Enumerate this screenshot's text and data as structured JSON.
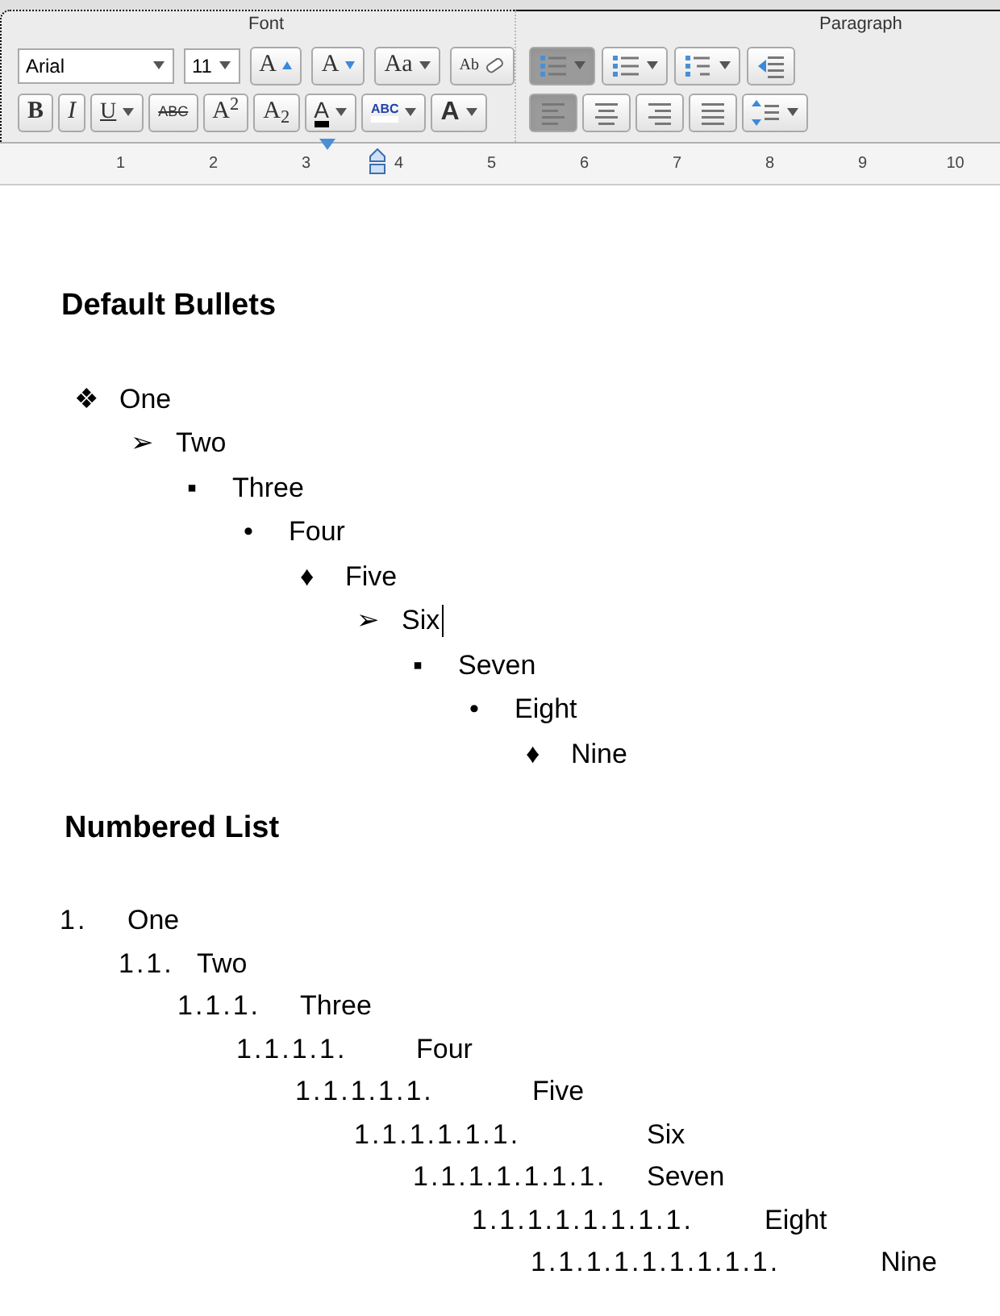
{
  "ribbon": {
    "font_group": {
      "title": "Font",
      "font_name": "Arial",
      "font_size": "11",
      "row1": [
        {
          "kind": "text",
          "label": "A"
        },
        {
          "kind": "text",
          "label": "A"
        },
        {
          "kind": "text",
          "label": "Aa"
        },
        {
          "kind": "text",
          "label": "Ab"
        }
      ],
      "row2": [
        {
          "kind": "text",
          "label": "B"
        },
        {
          "kind": "text",
          "label": "I"
        },
        {
          "kind": "text",
          "label": "U"
        },
        {
          "kind": "text",
          "label": "ABC"
        },
        {
          "kind": "text",
          "label": "A$^{2}$"
        },
        {
          "kind": "text",
          "label": "A$_{2}$"
        },
        {
          "kind": "text",
          "label": "A"
        },
        {
          "kind": "text",
          "label": "ABC"
        },
        {
          "kind": "text",
          "label": "A"
        }
      ]
    },
    "paragraph_group": {
      "title": "Paragraph",
      "row1": [
        {
          "kind": "icon",
          "selected": true
        },
        {
          "kind": "icon",
          "selected": false
        },
        {
          "kind": "icon",
          "selected": false
        },
        {
          "kind": "icon"
        }
      ],
      "row2": [
        {
          "kind": "icon",
          "selected": true
        },
        {
          "kind": "icon",
          "selected": false
        },
        {
          "kind": "icon",
          "selected": false
        },
        {
          "kind": "icon",
          "selected": false
        },
        {
          "kind": "icon"
        }
      ]
    }
  },
  "ruler": {
    "numbers": [
      "1",
      "2",
      "3",
      "4",
      "5",
      "6",
      "7",
      "8",
      "9",
      "10"
    ]
  },
  "document": {
    "sections": [
      {
        "heading": "Default Bullets",
        "kind": "bullets",
        "items": [
          {
            "marker": "❖",
            "text": "One",
            "children": [
              {
                "marker": "➢",
                "text": "Two",
                "children": [
                  {
                    "marker": "▪",
                    "text": "Three",
                    "children": [
                      {
                        "marker": "•",
                        "text": "Four",
                        "children": [
                          {
                            "marker": "♦",
                            "text": "Five",
                            "children": [
                              {
                                "marker": "➢",
                                "text": "Six",
                                "caret": true,
                                "children": [
                                  {
                                    "marker": "▪",
                                    "text": "Seven",
                                    "children": [
                                      {
                                        "marker": "•",
                                        "text": "Eight",
                                        "children": [
                                          {
                                            "marker": "♦",
                                            "text": "Nine"
                                          }
                                        ]
                                      }
                                    ]
                                  }
                                ]
                              }
                            ]
                          }
                        ]
                      }
                    ]
                  }
                ]
              }
            ]
          }
        ]
      },
      {
        "heading": "Numbered List",
        "kind": "numbers",
        "items": [
          {
            "marker": "1.",
            "text": "One",
            "children": [
              {
                "marker": "1.1.",
                "text": "Two",
                "children": [
                  {
                    "marker": "1.1.1.",
                    "text": "Three",
                    "children": [
                      {
                        "marker": "1.1.1.1.",
                        "text": "Four",
                        "children": [
                          {
                            "marker": "1.1.1.1.1.",
                            "text": "Five",
                            "children": [
                              {
                                "marker": "1.1.1.1.1.1.",
                                "text": "Six",
                                "children": [
                                  {
                                    "marker": "1.1.1.1.1.1.1.",
                                    "text": "Seven",
                                    "children": [
                                      {
                                        "marker": "1.1.1.1.1.1.1.1.",
                                        "text": "Eight",
                                        "children": [
                                          {
                                            "marker": "1.1.1.1.1.1.1.1.1.",
                                            "text": "Nine"
                                          }
                                        ]
                                      }
                                    ]
                                  }
                                ]
                              }
                            ]
                          }
                        ]
                      }
                    ]
                  }
                ]
              }
            ]
          }
        ]
      }
    ]
  }
}
